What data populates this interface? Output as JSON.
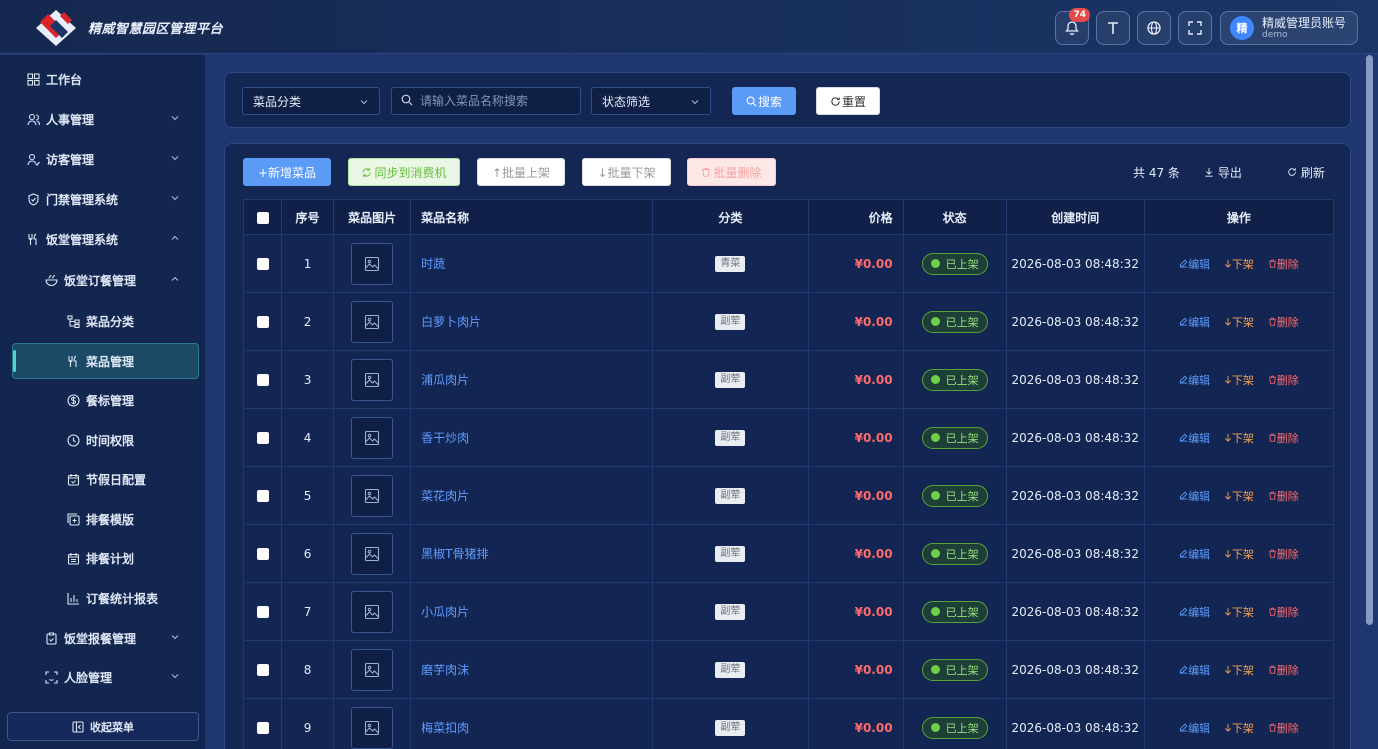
{
  "header": {
    "app_title": "精威智慧园区管理平台",
    "notification_count": "74",
    "user_avatar_text": "精",
    "user_name": "精威管理员账号",
    "user_sub": "demo"
  },
  "sidebar": {
    "items": [
      {
        "label": "工作台"
      },
      {
        "label": "人事管理"
      },
      {
        "label": "访客管理"
      },
      {
        "label": "门禁管理系统"
      },
      {
        "label": "饭堂管理系统"
      },
      {
        "label": "饭堂订餐管理"
      },
      {
        "label": "菜品分类"
      },
      {
        "label": "菜品管理"
      },
      {
        "label": "餐标管理"
      },
      {
        "label": "时间权限"
      },
      {
        "label": "节假日配置"
      },
      {
        "label": "排餐模版"
      },
      {
        "label": "排餐计划"
      },
      {
        "label": "订餐统计报表"
      },
      {
        "label": "饭堂报餐管理"
      },
      {
        "label": "人脸管理"
      }
    ],
    "collapse_label": "收起菜单"
  },
  "filters": {
    "category_select": "菜品分类",
    "search_placeholder": "请输入菜品名称搜索",
    "status_select": "状态筛选",
    "search_button": "搜索",
    "reset_button": "重置"
  },
  "toolbar": {
    "add_label": "+新增菜品",
    "sync_label": "同步到消费机",
    "batch_up_label": "↑批量上架",
    "batch_down_label": "↓批量下架",
    "batch_delete_label": "批量删除",
    "total_label": "共 47 条",
    "export_label": "导出",
    "refresh_label": "刷新"
  },
  "table": {
    "headers": [
      "序号",
      "菜品图片",
      "菜品名称",
      "分类",
      "价格",
      "状态",
      "创建时间",
      "操作"
    ],
    "ops": {
      "edit": "编辑",
      "down": "下架",
      "delete": "删除"
    },
    "rows": [
      {
        "index": "1",
        "name": "时蔬",
        "category": "青菜",
        "price": "¥0.00",
        "status": "已上架",
        "created": "2026-08-03 08:48:32"
      },
      {
        "index": "2",
        "name": "白萝卜肉片",
        "category": "副荤",
        "price": "¥0.00",
        "status": "已上架",
        "created": "2026-08-03 08:48:32"
      },
      {
        "index": "3",
        "name": "浦瓜肉片",
        "category": "副荤",
        "price": "¥0.00",
        "status": "已上架",
        "created": "2026-08-03 08:48:32"
      },
      {
        "index": "4",
        "name": "香干炒肉",
        "category": "副荤",
        "price": "¥0.00",
        "status": "已上架",
        "created": "2026-08-03 08:48:32"
      },
      {
        "index": "5",
        "name": "菜花肉片",
        "category": "副荤",
        "price": "¥0.00",
        "status": "已上架",
        "created": "2026-08-03 08:48:32"
      },
      {
        "index": "6",
        "name": "黑椒T骨猪排",
        "category": "副荤",
        "price": "¥0.00",
        "status": "已上架",
        "created": "2026-08-03 08:48:32"
      },
      {
        "index": "7",
        "name": "小瓜肉片",
        "category": "副荤",
        "price": "¥0.00",
        "status": "已上架",
        "created": "2026-08-03 08:48:32"
      },
      {
        "index": "8",
        "name": "磨芋肉沫",
        "category": "副荤",
        "price": "¥0.00",
        "status": "已上架",
        "created": "2026-08-03 08:48:32"
      },
      {
        "index": "9",
        "name": "梅菜扣肉",
        "category": "副荤",
        "price": "¥0.00",
        "status": "已上架",
        "created": "2026-08-03 08:48:32"
      }
    ]
  }
}
